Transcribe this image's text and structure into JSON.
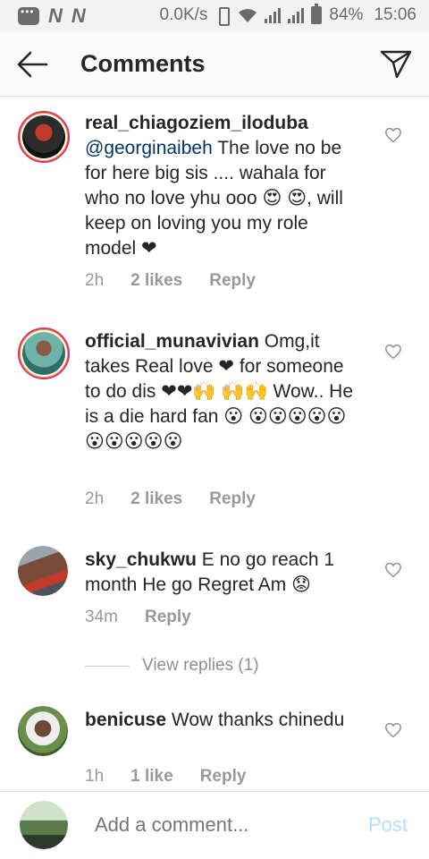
{
  "status_bar": {
    "net1": "N",
    "net2": "N",
    "speed": "0.0K/s",
    "battery": "84%",
    "time": "15:06"
  },
  "header": {
    "title": "Comments",
    "back_icon": "arrow-left-icon",
    "send_icon": "paper-plane-icon"
  },
  "comments": [
    {
      "username": "real_chiagoziem_iloduba",
      "mention": "@georginaibeh",
      "text": " The love no be for here big sis .... wahala for who no love yhu ooo 😍 😍, will keep on loving you my role model ❤",
      "time": "2h",
      "likes": "2 likes",
      "reply": "Reply"
    },
    {
      "username": "official_munavivian",
      "text": " Omg,it takes Real love ❤ for someone to do dis ❤❤🙌 🙌🙌 Wow.. He is a die hard fan 😮 😮😮😮😮😮😮😮😮😮😮",
      "time": "2h",
      "likes": "2 likes",
      "reply": "Reply"
    },
    {
      "username": "sky_chukwu",
      "text": " E no go reach 1 month He go Regret  Am 😟",
      "time": "34m",
      "reply": "Reply",
      "view_replies": "View replies (1)"
    },
    {
      "username": "benicuse",
      "text": " Wow thanks chinedu",
      "time": "1h",
      "likes": "1 like",
      "reply": "Reply"
    }
  ],
  "footer": {
    "placeholder": "Add a comment...",
    "post_label": "Post"
  },
  "colors": {
    "accent_blue": "#003569",
    "post_disabled": "#b2dffc",
    "meta_gray": "#999999",
    "story_ring": "#d6336c"
  }
}
